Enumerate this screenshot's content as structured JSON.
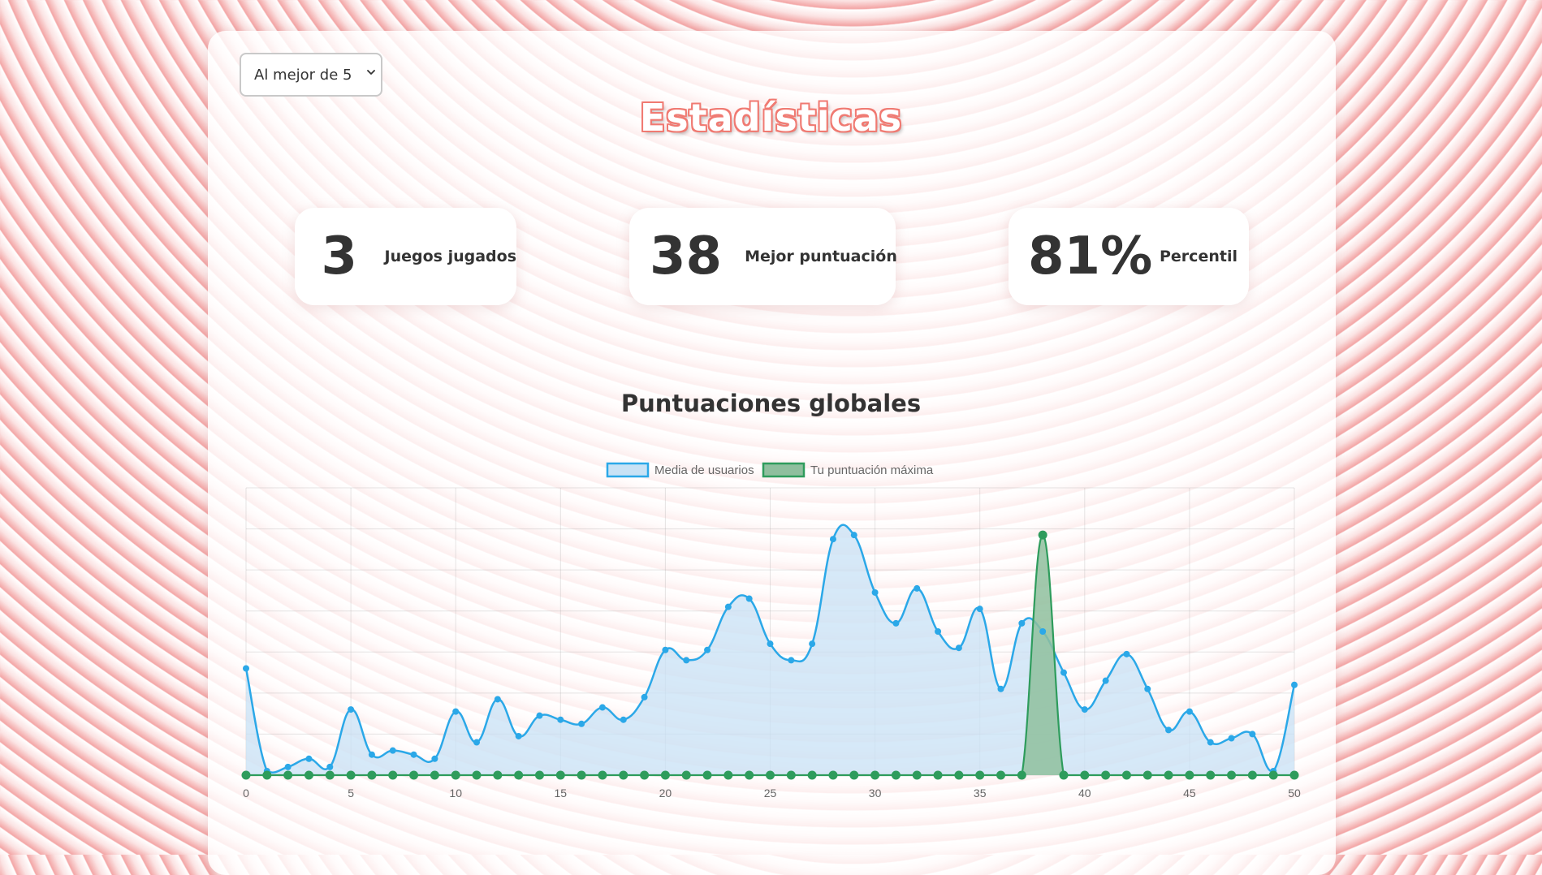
{
  "mode_select": {
    "value": "Al mejor de 5",
    "options": [
      "Al mejor de 5"
    ]
  },
  "page_title": "Estadísticas",
  "stats": [
    {
      "value": "3",
      "label": "Juegos jugados"
    },
    {
      "value": "38",
      "label": "Mejor puntuación"
    },
    {
      "value": "81%",
      "label": "Percentil"
    }
  ],
  "colors": {
    "title": "#f07a72",
    "user_avg_line": "#2ba8e8",
    "user_avg_fill": "#c8e2f5",
    "best_line": "#2e9c5c",
    "best_fill": "#8fbf9e"
  },
  "chart_data": {
    "type": "line",
    "title": "Puntuaciones globales",
    "x": [
      0,
      1,
      2,
      3,
      4,
      5,
      6,
      7,
      8,
      9,
      10,
      11,
      12,
      13,
      14,
      15,
      16,
      17,
      18,
      19,
      20,
      21,
      22,
      23,
      24,
      25,
      26,
      27,
      28,
      29,
      30,
      31,
      32,
      33,
      34,
      35,
      36,
      37,
      38,
      39,
      40,
      41,
      42,
      43,
      44,
      45,
      46,
      47,
      48,
      49,
      50
    ],
    "x_ticks": [
      0,
      5,
      10,
      15,
      20,
      25,
      30,
      35,
      40,
      45,
      50
    ],
    "xlim": [
      0,
      50
    ],
    "ylim": [
      0,
      7
    ],
    "y_tick_labels_shown": false,
    "grid": true,
    "legend_position": "top",
    "series": [
      {
        "name": "Media de usuarios",
        "values": [
          2.6,
          0.1,
          0.2,
          0.4,
          0.2,
          1.6,
          0.5,
          0.6,
          0.5,
          0.4,
          1.55,
          0.8,
          1.85,
          0.95,
          1.45,
          1.35,
          1.25,
          1.65,
          1.35,
          1.9,
          3.05,
          2.8,
          3.05,
          4.1,
          4.3,
          3.2,
          2.8,
          3.2,
          5.75,
          5.85,
          4.45,
          3.7,
          4.55,
          3.5,
          3.1,
          4.05,
          2.1,
          3.7,
          3.5,
          2.5,
          1.6,
          2.3,
          2.95,
          2.1,
          1.1,
          1.55,
          0.8,
          0.9,
          1.0,
          0.1,
          2.2
        ]
      },
      {
        "name": "Tu puntuación máxima",
        "values": [
          0,
          0,
          0,
          0,
          0,
          0,
          0,
          0,
          0,
          0,
          0,
          0,
          0,
          0,
          0,
          0,
          0,
          0,
          0,
          0,
          0,
          0,
          0,
          0,
          0,
          0,
          0,
          0,
          0,
          0,
          0,
          0,
          0,
          0,
          0,
          0,
          0,
          0,
          5.85,
          0,
          0,
          0,
          0,
          0,
          0,
          0,
          0,
          0,
          0,
          0,
          0
        ]
      }
    ]
  }
}
